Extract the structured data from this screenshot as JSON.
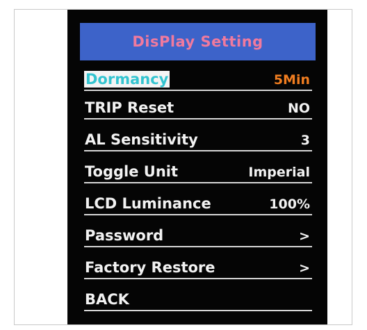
{
  "title": "DisPlay Setting",
  "menu": [
    {
      "label": "Dormancy",
      "value": "5Min"
    },
    {
      "label": "TRIP Reset",
      "value": "NO"
    },
    {
      "label": "AL Sensitivity",
      "value": "3"
    },
    {
      "label": "Toggle Unit",
      "value": "Imperial"
    },
    {
      "label": "LCD Luminance",
      "value": "100%"
    },
    {
      "label": "Password",
      "value": ">"
    },
    {
      "label": "Factory Restore",
      "value": ">"
    },
    {
      "label": "BACK",
      "value": ""
    }
  ],
  "colors": {
    "header_bg": "#3d63c9",
    "header_text": "#f07a9e",
    "selected_label": "#33c4d0",
    "selected_value": "#f07d20",
    "screen_bg": "#050505"
  }
}
